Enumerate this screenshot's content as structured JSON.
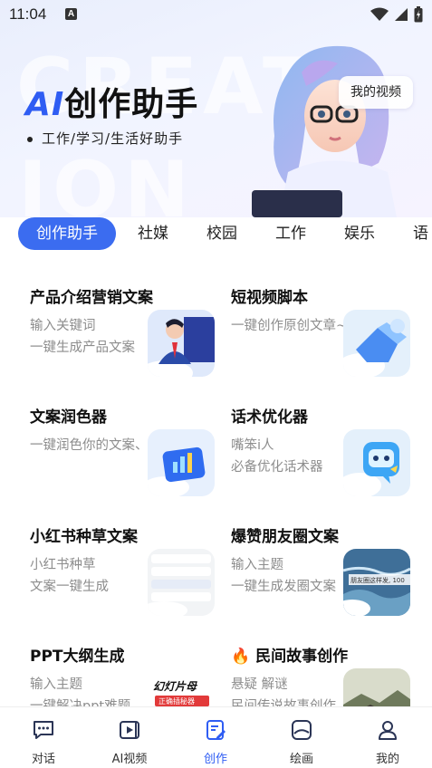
{
  "status_bar": {
    "time": "11:04",
    "notification_letter": "A"
  },
  "hero": {
    "title_prefix": "AI",
    "title_rest": "创作助手",
    "subtitle": "工作/学习/生活好助手",
    "bg_word_1": "CREAT",
    "bg_word_2": "ION",
    "my_video_label": "我的视频"
  },
  "tabs": [
    "创作助手",
    "社媒",
    "校园",
    "工作",
    "娱乐",
    "语"
  ],
  "cards": [
    {
      "title": "产品介绍营销文案",
      "desc1": "输入关键词",
      "desc2": "一键生成产品文案",
      "icon": "businessman-thumbnail"
    },
    {
      "title": "短视频脚本",
      "desc1": "一键创作原创文章~",
      "desc2": "",
      "icon": "3d-arrow-thumbnail"
    },
    {
      "title": "文案润色器",
      "desc1": "一键润色你的文案、文章",
      "desc2": "",
      "icon": "chart-folder-thumbnail"
    },
    {
      "title": "话术优化器",
      "desc1": "嘴笨i人",
      "desc2": "必备优化话术器",
      "icon": "chat-robot-thumbnail"
    },
    {
      "title": "小红书种草文案",
      "desc1": "小红书种草",
      "desc2": "文案一键生成",
      "icon": "notes-thumbnail"
    },
    {
      "title": "爆赞朋友圈文案",
      "desc1": "输入主题",
      "desc2": "一键生成发圈文案",
      "icon": "ocean-thumbnail"
    },
    {
      "title": "PPT大纲生成",
      "desc1": "输入主题",
      "desc2": "一键解决ppt难题",
      "icon": "slides-poster-thumbnail"
    },
    {
      "title": "民间故事创作",
      "desc1": "悬疑 解谜",
      "desc2": "民间传说故事创作",
      "icon": "ancient-town-thumbnail",
      "emoji": "🔥"
    }
  ],
  "thumb_text": {
    "ocean": "朋友圈这样发, 100",
    "ppt_line1": "幻灯片母",
    "ppt_line2": "正确插秘器"
  },
  "nav": [
    {
      "label": "对话",
      "icon": "chat-icon"
    },
    {
      "label": "AI视频",
      "icon": "video-icon"
    },
    {
      "label": "创作",
      "icon": "create-icon",
      "active": true
    },
    {
      "label": "绘画",
      "icon": "paint-icon"
    },
    {
      "label": "我的",
      "icon": "profile-icon"
    }
  ],
  "colors": {
    "accent": "#3b6cf0",
    "text": "#222222",
    "muted": "#8d8d8d"
  }
}
